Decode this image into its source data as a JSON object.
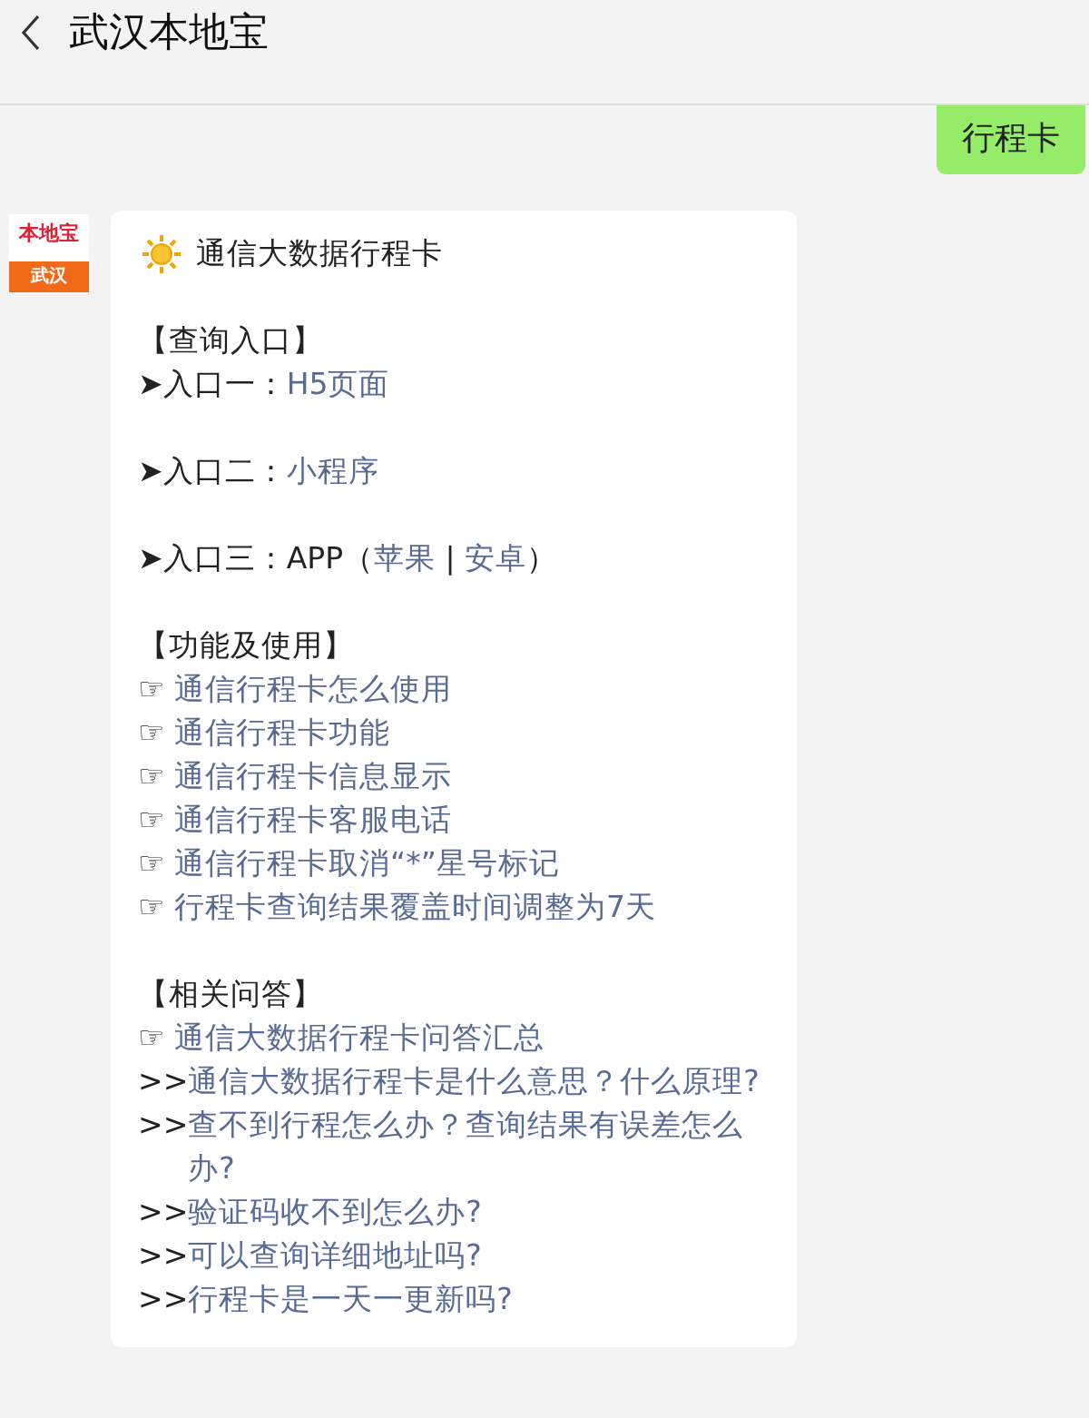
{
  "header": {
    "title": "武汉本地宝"
  },
  "messages": [
    {
      "kind": "outgoing",
      "text": "行程卡"
    },
    {
      "kind": "incoming",
      "avatar": {
        "brand": "本地宝",
        "city": "武汉"
      },
      "title": "通信大数据行程卡",
      "paragraphs": [
        [
          [
            {
              "text": "【查询入口】",
              "link": false
            }
          ],
          [
            {
              "text": "➤入口一：",
              "link": false
            },
            {
              "text": "H5页面",
              "link": true
            }
          ]
        ],
        [
          [
            {
              "text": "➤入口二：",
              "link": false
            },
            {
              "text": "小程序",
              "link": true
            }
          ]
        ],
        [
          [
            {
              "text": "➤入口三：APP（",
              "link": false
            },
            {
              "text": "苹果",
              "link": true
            },
            {
              "text": " | ",
              "link": false
            },
            {
              "text": "安卓",
              "link": true
            },
            {
              "text": "）",
              "link": false
            }
          ]
        ],
        [
          [
            {
              "text": "【功能及使用】",
              "link": false
            }
          ],
          [
            {
              "text": "☞ ",
              "link": false
            },
            {
              "text": "通信行程卡怎么使用",
              "link": true
            }
          ],
          [
            {
              "text": "☞ ",
              "link": false
            },
            {
              "text": "通信行程卡功能",
              "link": true
            }
          ],
          [
            {
              "text": "☞ ",
              "link": false
            },
            {
              "text": "通信行程卡信息显示",
              "link": true
            }
          ],
          [
            {
              "text": "☞ ",
              "link": false
            },
            {
              "text": "通信行程卡客服电话",
              "link": true
            }
          ],
          [
            {
              "text": "☞ ",
              "link": false
            },
            {
              "text": "通信行程卡取消“*”星号标记",
              "link": true
            }
          ],
          [
            {
              "text": "☞ ",
              "link": false
            },
            {
              "text": "行程卡查询结果覆盖时间调整为7天",
              "link": true
            }
          ]
        ],
        [
          [
            {
              "text": "【相关问答】",
              "link": false
            }
          ],
          [
            {
              "text": "☞ ",
              "link": false
            },
            {
              "text": "通信大数据行程卡问答汇总",
              "link": true
            }
          ],
          [
            {
              "text": ">>",
              "link": false
            },
            {
              "text": "通信大数据行程卡是什么意思？什么原理?",
              "link": true
            }
          ],
          [
            {
              "text": ">>",
              "link": false
            },
            {
              "text": "查不到行程怎么办？查询结果有误差怎么办?",
              "link": true
            }
          ],
          [
            {
              "text": ">>",
              "link": false
            },
            {
              "text": "验证码收不到怎么办?",
              "link": true
            }
          ],
          [
            {
              "text": ">>",
              "link": false
            },
            {
              "text": "可以查询详细地址吗?",
              "link": true
            }
          ],
          [
            {
              "text": ">>",
              "link": false
            },
            {
              "text": "行程卡是一天一更新吗?",
              "link": true
            }
          ]
        ]
      ]
    }
  ]
}
